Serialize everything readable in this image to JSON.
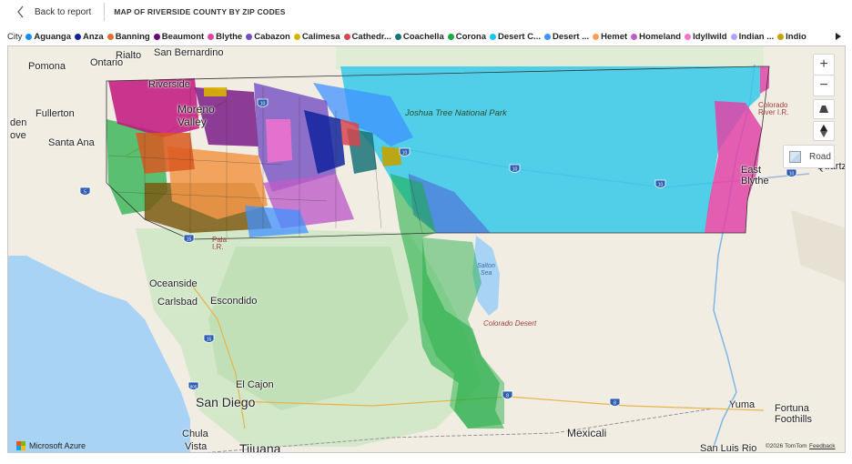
{
  "header": {
    "back_label": "Back to report",
    "title": "MAP OF RIVERSIDE COUNTY BY ZIP CODES"
  },
  "legend": {
    "title": "City",
    "items": [
      {
        "label": "Aguanga",
        "color": "#118DFF"
      },
      {
        "label": "Anza",
        "color": "#12239E"
      },
      {
        "label": "Banning",
        "color": "#E66C37"
      },
      {
        "label": "Beaumont",
        "color": "#6B007B"
      },
      {
        "label": "Blythe",
        "color": "#E044A7"
      },
      {
        "label": "Cabazon",
        "color": "#744EC2"
      },
      {
        "label": "Calimesa",
        "color": "#D9B300"
      },
      {
        "label": "Cathedr...",
        "color": "#D64550"
      },
      {
        "label": "Coachella",
        "color": "#197278"
      },
      {
        "label": "Corona",
        "color": "#1AAB40"
      },
      {
        "label": "Desert C...",
        "color": "#15C6F4"
      },
      {
        "label": "Desert ...",
        "color": "#4092FF"
      },
      {
        "label": "Hemet",
        "color": "#FFA058"
      },
      {
        "label": "Homeland",
        "color": "#BE5DC9"
      },
      {
        "label": "Idyllwild",
        "color": "#F472D0"
      },
      {
        "label": "Indian ...",
        "color": "#B5A1FF"
      },
      {
        "label": "Indio",
        "color": "#C4A200"
      }
    ]
  },
  "map": {
    "labels": {
      "rialto": "Rialto",
      "san_bernardino": "San Bernardino",
      "pomona": "Pomona",
      "ontario": "Ontario",
      "riverside": "Riverside",
      "moreno": "Moreno",
      "valley": "Valley",
      "fullerton": "Fullerton",
      "den": "den",
      "ove": "ove",
      "santa_ana": "Santa Ana",
      "joshua_tree": "Joshua Tree National Park",
      "colorado_river_1": "Colorado",
      "colorado_river_2": "River I.R.",
      "east": "East",
      "blythe": "Blythe",
      "quartz": "Quartz",
      "pala_1": "Pala",
      "pala_2": "I.R.",
      "oceanside": "Oceanside",
      "carlsbad": "Carlsbad",
      "escondido": "Escondido",
      "salton_1": "Salton",
      "salton_2": "Sea",
      "colorado_desert": "Colorado Desert",
      "el_cajon": "El Cajon",
      "san_diego": "San Diego",
      "chula_1": "Chula",
      "chula_2": "Vista",
      "tijuana": "Tijuana",
      "mexicali": "Mexicali",
      "yuma": "Yuma",
      "fortuna_1": "Fortuna",
      "fortuna_2": "Foothills",
      "san_luis": "San Luis Rio"
    },
    "highways": [
      "5",
      "10",
      "10",
      "10",
      "10",
      "15",
      "15",
      "8",
      "8",
      "805",
      "10"
    ]
  },
  "controls": {
    "zoom_in": "+",
    "zoom_out": "−",
    "style_label": "Road"
  },
  "footer": {
    "brand": "Microsoft Azure",
    "copyright": "©2026 TomTom",
    "feedback": "Feedback"
  }
}
